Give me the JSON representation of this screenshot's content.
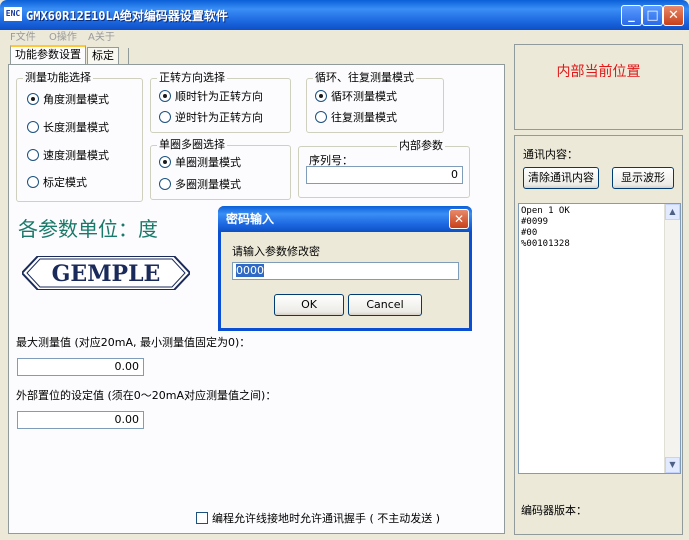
{
  "window": {
    "title": "GMX60R12E10LA绝对编码器设置软件",
    "icon_text": "ENC"
  },
  "menu": [
    "F文件",
    "O操作",
    "A关于"
  ],
  "tabs": [
    "功能参数设置",
    "标定"
  ],
  "measure_mode": {
    "legend": "测量功能选择",
    "options": [
      "角度测量模式",
      "长度测量模式",
      "速度测量模式",
      "标定模式"
    ],
    "selected": 0
  },
  "direction": {
    "legend": "正转方向选择",
    "options": [
      "顺时针为正转方向",
      "逆时针为正转方向"
    ],
    "selected": 0
  },
  "cycle_mode": {
    "legend": "循环、往复测量模式",
    "options": [
      "循环测量模式",
      "往复测量模式"
    ],
    "selected": 0
  },
  "turns_mode": {
    "legend": "单圈多圈选择",
    "options": [
      "单圈测量模式",
      "多圈测量模式"
    ],
    "selected": 0
  },
  "internal_params": {
    "legend": "内部参数",
    "serial_label": "序列号：",
    "serial_value": "0"
  },
  "units_label": "各参数单位：度",
  "logo_text": "GEMPLE",
  "max_measure": {
    "label": "最大测量值 (对应20mA, 最小测量值固定为0)：",
    "value": "0.00"
  },
  "external_preset": {
    "label": "外部置位的设定值 (须在0～20mA对应测量值之间)：",
    "value": "0.00"
  },
  "handshake_checkbox": "编程允许线接地时允许通讯握手 ( 不主动发送 )",
  "position_panel": {
    "title": "内部当前位置"
  },
  "comm_panel": {
    "title": "通讯内容：",
    "clear_button": "清除通讯内容",
    "wave_button": "显示波形",
    "log": [
      "Open 1 OK",
      "#0099",
      "#00",
      "%00101328"
    ],
    "version_label": "编码器版本："
  },
  "dialog": {
    "title": "密码输入",
    "prompt": "请输入参数修改密",
    "input_value": "0000",
    "ok": "OK",
    "cancel": "Cancel"
  },
  "colors": {
    "position_title": "#e01818",
    "units_label": "#1a7a6a",
    "titlebar": "#1d68e0"
  }
}
